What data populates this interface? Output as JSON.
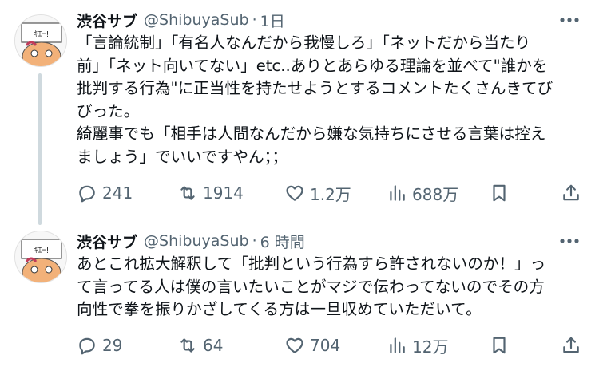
{
  "tweets": [
    {
      "name": "渋谷サブ",
      "handle": "@ShibuyaSub",
      "separator": "·",
      "time": "1日",
      "avatar_text": "ｷｴｰ!",
      "text": "「言論統制」「有名人なんだから我慢しろ」「ネットだから当たり\n前」「ネット向いてない」etc..ありとあらゆる理論を並べて\"誰かを\n批判する行為\"に正当性を持たせようとするコメントたくさんきてび\nびった。\n綺麗事でも「相手は人間なんだから嫌な気持ちにさせる言葉は控え\nましょう」でいいですやん；；",
      "replies": "241",
      "retweets": "1914",
      "likes": "1.2万",
      "views": "688万"
    },
    {
      "name": "渋谷サブ",
      "handle": "@ShibuyaSub",
      "separator": "·",
      "time": "6 時間",
      "avatar_text": "ｷｴｰ!",
      "text": "あとこれ拡大解釈して「批判という行為すら許されないのか！」っ\nて言ってる人は僕の言いたいことがマジで伝わってないのでその方\n向性で拳を振りかざしてくる方は一旦収めていただいて。",
      "replies": "29",
      "retweets": "64",
      "likes": "704",
      "views": "12万"
    }
  ],
  "icons": {
    "reply": "reply-icon",
    "retweet": "retweet-icon",
    "like": "heart-icon",
    "views": "views-chart-icon",
    "bookmark": "bookmark-icon",
    "share": "share-icon",
    "more": "more-dots-icon"
  },
  "colors": {
    "text": "#0f1419",
    "secondary": "#536471",
    "thread_line": "#cfd9de"
  }
}
